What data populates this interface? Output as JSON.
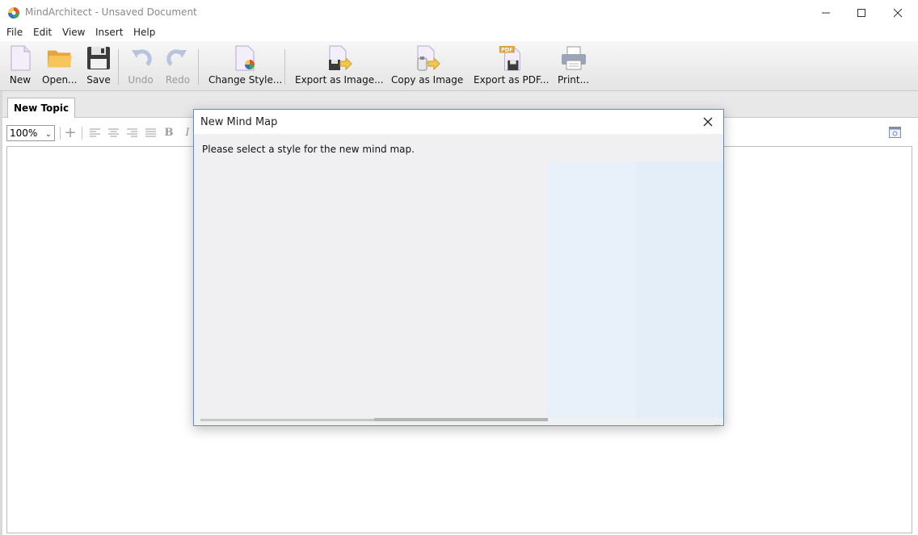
{
  "window": {
    "title": "MindArchitect - Unsaved Document"
  },
  "menu": [
    "File",
    "Edit",
    "View",
    "Insert",
    "Help"
  ],
  "toolbar": {
    "new": "New",
    "open": "Open...",
    "save": "Save",
    "undo": "Undo",
    "redo": "Redo",
    "change_style": "Change Style...",
    "export_image": "Export as Image...",
    "copy_image": "Copy as Image",
    "export_pdf": "Export as PDF...",
    "pdf_badge": "PDF",
    "print": "Print..."
  },
  "tabs": {
    "active": "New Topic"
  },
  "format": {
    "zoom": "100%",
    "add": "+",
    "bold": "B",
    "italic": "I"
  },
  "dialog": {
    "title": "New Mind Map",
    "message": "Please select a style for the new mind map."
  },
  "colors": {
    "dialog_border": "#5b8ec9",
    "dialog_bg": "#f0eff2",
    "selection_bg": "#e8f1fa"
  }
}
